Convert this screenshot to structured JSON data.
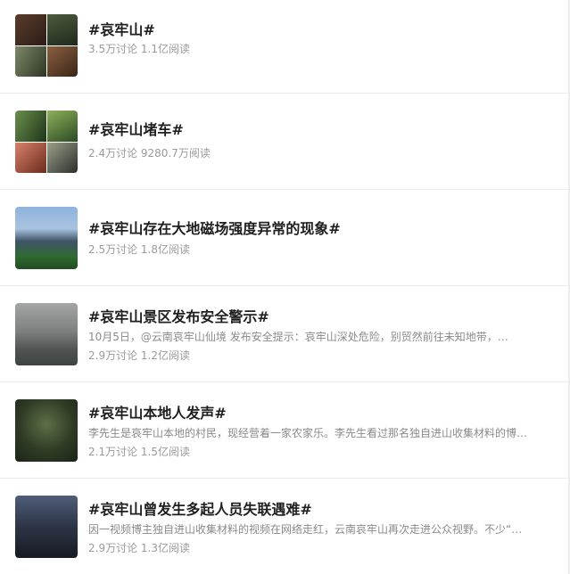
{
  "topics": [
    {
      "title": "#哀牢山#",
      "desc": "",
      "stats": "3.5万讨论 1.1亿阅读",
      "thumb_colors": [
        "#3e2a22",
        "#2f3d2a",
        "#46513c",
        "#6a4a35"
      ]
    },
    {
      "title": "#哀牢山堵车#",
      "desc": "",
      "stats": "2.4万讨论 9280.7万阅读",
      "thumb_colors": [
        "#2e4b2a",
        "#3f6b34",
        "#b5563e",
        "#5b5f57"
      ]
    },
    {
      "title": "#哀牢山存在大地磁场强度异常的现象#",
      "desc": "",
      "stats": "2.5万讨论 1.8亿阅读",
      "thumb_colors": [
        "#6e93c4",
        "#2c4057"
      ]
    },
    {
      "title": "#哀牢山景区发布安全警示#",
      "desc": "10月5日，@云南哀牢山仙境 发布安全提示：哀牢山深处危险，别贸然前往未知地带，…",
      "stats": "2.9万讨论 1.2亿阅读",
      "thumb_colors": [
        "#8c8f8d",
        "#5b605e"
      ]
    },
    {
      "title": "#哀牢山本地人发声#",
      "desc": "李先生是哀牢山本地的村民，现经营着一家农家乐。李先生看过那名独自进山收集材料的博…",
      "stats": "2.1万讨论 1.5亿阅读",
      "thumb_colors": [
        "#2f3a26",
        "#50613c"
      ]
    },
    {
      "title": "#哀牢山曾发生多起人员失联遇难#",
      "desc": "因一视频博主独自进山收集材料的视频在网络走红，云南哀牢山再次走进公众视野。不少“…",
      "stats": "2.9万讨论 1.3亿阅读",
      "thumb_colors": [
        "#2b3444",
        "#1b1f28"
      ]
    }
  ]
}
